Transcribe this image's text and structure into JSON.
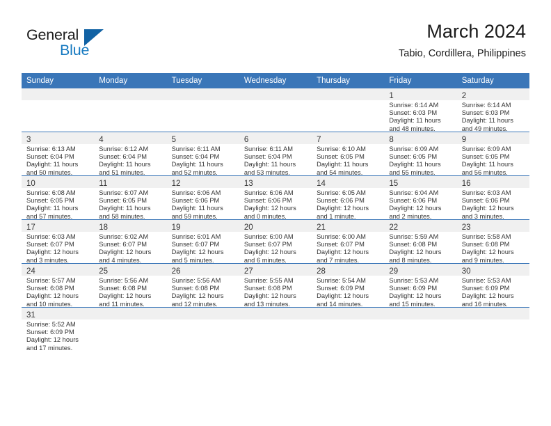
{
  "logo": {
    "word_one": "General",
    "word_two": "Blue",
    "icon": "triangle-mark",
    "color_dark": "#1b1b1b",
    "color_blue": "#1679c0",
    "color_triangle": "#1162a4"
  },
  "header": {
    "month_title": "March 2024",
    "location": "Tabio, Cordillera, Philippines"
  },
  "theme": {
    "header_bg": "#3a76b8",
    "daynum_bg": "#f0f0f0",
    "grid_line": "#3a76b8",
    "text": "#333333"
  },
  "weekday_headers": [
    "Sunday",
    "Monday",
    "Tuesday",
    "Wednesday",
    "Thursday",
    "Friday",
    "Saturday"
  ],
  "weeks": [
    [
      {
        "day": "",
        "empty": true,
        "sunrise": "",
        "sunset": "",
        "daylight_line1": "",
        "daylight_line2": ""
      },
      {
        "day": "",
        "empty": true,
        "sunrise": "",
        "sunset": "",
        "daylight_line1": "",
        "daylight_line2": ""
      },
      {
        "day": "",
        "empty": true,
        "sunrise": "",
        "sunset": "",
        "daylight_line1": "",
        "daylight_line2": ""
      },
      {
        "day": "",
        "empty": true,
        "sunrise": "",
        "sunset": "",
        "daylight_line1": "",
        "daylight_line2": ""
      },
      {
        "day": "",
        "empty": true,
        "sunrise": "",
        "sunset": "",
        "daylight_line1": "",
        "daylight_line2": ""
      },
      {
        "day": "1",
        "empty": false,
        "sunrise": "Sunrise: 6:14 AM",
        "sunset": "Sunset: 6:03 PM",
        "daylight_line1": "Daylight: 11 hours",
        "daylight_line2": "and 48 minutes."
      },
      {
        "day": "2",
        "empty": false,
        "sunrise": "Sunrise: 6:14 AM",
        "sunset": "Sunset: 6:03 PM",
        "daylight_line1": "Daylight: 11 hours",
        "daylight_line2": "and 49 minutes."
      }
    ],
    [
      {
        "day": "3",
        "empty": false,
        "sunrise": "Sunrise: 6:13 AM",
        "sunset": "Sunset: 6:04 PM",
        "daylight_line1": "Daylight: 11 hours",
        "daylight_line2": "and 50 minutes."
      },
      {
        "day": "4",
        "empty": false,
        "sunrise": "Sunrise: 6:12 AM",
        "sunset": "Sunset: 6:04 PM",
        "daylight_line1": "Daylight: 11 hours",
        "daylight_line2": "and 51 minutes."
      },
      {
        "day": "5",
        "empty": false,
        "sunrise": "Sunrise: 6:11 AM",
        "sunset": "Sunset: 6:04 PM",
        "daylight_line1": "Daylight: 11 hours",
        "daylight_line2": "and 52 minutes."
      },
      {
        "day": "6",
        "empty": false,
        "sunrise": "Sunrise: 6:11 AM",
        "sunset": "Sunset: 6:04 PM",
        "daylight_line1": "Daylight: 11 hours",
        "daylight_line2": "and 53 minutes."
      },
      {
        "day": "7",
        "empty": false,
        "sunrise": "Sunrise: 6:10 AM",
        "sunset": "Sunset: 6:05 PM",
        "daylight_line1": "Daylight: 11 hours",
        "daylight_line2": "and 54 minutes."
      },
      {
        "day": "8",
        "empty": false,
        "sunrise": "Sunrise: 6:09 AM",
        "sunset": "Sunset: 6:05 PM",
        "daylight_line1": "Daylight: 11 hours",
        "daylight_line2": "and 55 minutes."
      },
      {
        "day": "9",
        "empty": false,
        "sunrise": "Sunrise: 6:09 AM",
        "sunset": "Sunset: 6:05 PM",
        "daylight_line1": "Daylight: 11 hours",
        "daylight_line2": "and 56 minutes."
      }
    ],
    [
      {
        "day": "10",
        "empty": false,
        "sunrise": "Sunrise: 6:08 AM",
        "sunset": "Sunset: 6:05 PM",
        "daylight_line1": "Daylight: 11 hours",
        "daylight_line2": "and 57 minutes."
      },
      {
        "day": "11",
        "empty": false,
        "sunrise": "Sunrise: 6:07 AM",
        "sunset": "Sunset: 6:05 PM",
        "daylight_line1": "Daylight: 11 hours",
        "daylight_line2": "and 58 minutes."
      },
      {
        "day": "12",
        "empty": false,
        "sunrise": "Sunrise: 6:06 AM",
        "sunset": "Sunset: 6:06 PM",
        "daylight_line1": "Daylight: 11 hours",
        "daylight_line2": "and 59 minutes."
      },
      {
        "day": "13",
        "empty": false,
        "sunrise": "Sunrise: 6:06 AM",
        "sunset": "Sunset: 6:06 PM",
        "daylight_line1": "Daylight: 12 hours",
        "daylight_line2": "and 0 minutes."
      },
      {
        "day": "14",
        "empty": false,
        "sunrise": "Sunrise: 6:05 AM",
        "sunset": "Sunset: 6:06 PM",
        "daylight_line1": "Daylight: 12 hours",
        "daylight_line2": "and 1 minute."
      },
      {
        "day": "15",
        "empty": false,
        "sunrise": "Sunrise: 6:04 AM",
        "sunset": "Sunset: 6:06 PM",
        "daylight_line1": "Daylight: 12 hours",
        "daylight_line2": "and 2 minutes."
      },
      {
        "day": "16",
        "empty": false,
        "sunrise": "Sunrise: 6:03 AM",
        "sunset": "Sunset: 6:06 PM",
        "daylight_line1": "Daylight: 12 hours",
        "daylight_line2": "and 3 minutes."
      }
    ],
    [
      {
        "day": "17",
        "empty": false,
        "sunrise": "Sunrise: 6:03 AM",
        "sunset": "Sunset: 6:07 PM",
        "daylight_line1": "Daylight: 12 hours",
        "daylight_line2": "and 3 minutes."
      },
      {
        "day": "18",
        "empty": false,
        "sunrise": "Sunrise: 6:02 AM",
        "sunset": "Sunset: 6:07 PM",
        "daylight_line1": "Daylight: 12 hours",
        "daylight_line2": "and 4 minutes."
      },
      {
        "day": "19",
        "empty": false,
        "sunrise": "Sunrise: 6:01 AM",
        "sunset": "Sunset: 6:07 PM",
        "daylight_line1": "Daylight: 12 hours",
        "daylight_line2": "and 5 minutes."
      },
      {
        "day": "20",
        "empty": false,
        "sunrise": "Sunrise: 6:00 AM",
        "sunset": "Sunset: 6:07 PM",
        "daylight_line1": "Daylight: 12 hours",
        "daylight_line2": "and 6 minutes."
      },
      {
        "day": "21",
        "empty": false,
        "sunrise": "Sunrise: 6:00 AM",
        "sunset": "Sunset: 6:07 PM",
        "daylight_line1": "Daylight: 12 hours",
        "daylight_line2": "and 7 minutes."
      },
      {
        "day": "22",
        "empty": false,
        "sunrise": "Sunrise: 5:59 AM",
        "sunset": "Sunset: 6:08 PM",
        "daylight_line1": "Daylight: 12 hours",
        "daylight_line2": "and 8 minutes."
      },
      {
        "day": "23",
        "empty": false,
        "sunrise": "Sunrise: 5:58 AM",
        "sunset": "Sunset: 6:08 PM",
        "daylight_line1": "Daylight: 12 hours",
        "daylight_line2": "and 9 minutes."
      }
    ],
    [
      {
        "day": "24",
        "empty": false,
        "sunrise": "Sunrise: 5:57 AM",
        "sunset": "Sunset: 6:08 PM",
        "daylight_line1": "Daylight: 12 hours",
        "daylight_line2": "and 10 minutes."
      },
      {
        "day": "25",
        "empty": false,
        "sunrise": "Sunrise: 5:56 AM",
        "sunset": "Sunset: 6:08 PM",
        "daylight_line1": "Daylight: 12 hours",
        "daylight_line2": "and 11 minutes."
      },
      {
        "day": "26",
        "empty": false,
        "sunrise": "Sunrise: 5:56 AM",
        "sunset": "Sunset: 6:08 PM",
        "daylight_line1": "Daylight: 12 hours",
        "daylight_line2": "and 12 minutes."
      },
      {
        "day": "27",
        "empty": false,
        "sunrise": "Sunrise: 5:55 AM",
        "sunset": "Sunset: 6:08 PM",
        "daylight_line1": "Daylight: 12 hours",
        "daylight_line2": "and 13 minutes."
      },
      {
        "day": "28",
        "empty": false,
        "sunrise": "Sunrise: 5:54 AM",
        "sunset": "Sunset: 6:09 PM",
        "daylight_line1": "Daylight: 12 hours",
        "daylight_line2": "and 14 minutes."
      },
      {
        "day": "29",
        "empty": false,
        "sunrise": "Sunrise: 5:53 AM",
        "sunset": "Sunset: 6:09 PM",
        "daylight_line1": "Daylight: 12 hours",
        "daylight_line2": "and 15 minutes."
      },
      {
        "day": "30",
        "empty": false,
        "sunrise": "Sunrise: 5:53 AM",
        "sunset": "Sunset: 6:09 PM",
        "daylight_line1": "Daylight: 12 hours",
        "daylight_line2": "and 16 minutes."
      }
    ],
    [
      {
        "day": "31",
        "empty": false,
        "sunrise": "Sunrise: 5:52 AM",
        "sunset": "Sunset: 6:09 PM",
        "daylight_line1": "Daylight: 12 hours",
        "daylight_line2": "and 17 minutes."
      },
      {
        "day": "",
        "empty": true,
        "sunrise": "",
        "sunset": "",
        "daylight_line1": "",
        "daylight_line2": ""
      },
      {
        "day": "",
        "empty": true,
        "sunrise": "",
        "sunset": "",
        "daylight_line1": "",
        "daylight_line2": ""
      },
      {
        "day": "",
        "empty": true,
        "sunrise": "",
        "sunset": "",
        "daylight_line1": "",
        "daylight_line2": ""
      },
      {
        "day": "",
        "empty": true,
        "sunrise": "",
        "sunset": "",
        "daylight_line1": "",
        "daylight_line2": ""
      },
      {
        "day": "",
        "empty": true,
        "sunrise": "",
        "sunset": "",
        "daylight_line1": "",
        "daylight_line2": ""
      },
      {
        "day": "",
        "empty": true,
        "sunrise": "",
        "sunset": "",
        "daylight_line1": "",
        "daylight_line2": ""
      }
    ]
  ]
}
